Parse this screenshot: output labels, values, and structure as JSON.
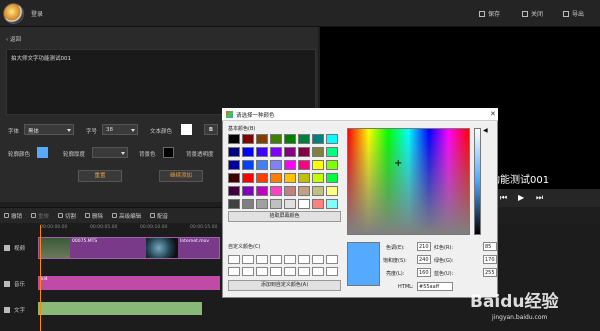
{
  "topbar": {
    "login_label": "登录",
    "buttons": [
      {
        "label": "保存",
        "icon": "save-icon"
      },
      {
        "label": "关闭",
        "icon": "close-icon"
      },
      {
        "label": "导出",
        "icon": "export-icon"
      }
    ]
  },
  "editor": {
    "back_label": "返回",
    "text_content": "拍大师文字功能测试001",
    "font_label": "字体",
    "font_value": "黑体",
    "size_label": "字号",
    "size_value": "38",
    "text_color_label": "文本颜色",
    "text_color": "#ffffff",
    "bold_label": "B",
    "outline_color_label": "轮廓颜色",
    "outline_color": "#55aaff",
    "outline_thickness_label": "轮廓厚度",
    "bg_color_label": "背景色",
    "bg_color": "#000000",
    "bg_opacity_label": "背景透明度",
    "reset_button": "重置",
    "continue_button": "继续添加"
  },
  "preview": {
    "overlay_text": "文字功能测试001"
  },
  "toolbar": {
    "items": [
      {
        "label": "撤销",
        "icon": "undo-icon",
        "disabled": false
      },
      {
        "label": "重做",
        "icon": "redo-icon",
        "disabled": true
      },
      {
        "label": "切割",
        "icon": "cut-icon",
        "disabled": false
      },
      {
        "label": "删除",
        "icon": "delete-icon",
        "disabled": false
      },
      {
        "label": "高级编辑",
        "icon": "advanced-edit-icon",
        "disabled": false
      },
      {
        "label": "配音",
        "icon": "microphone-icon",
        "disabled": false
      }
    ]
  },
  "timeline": {
    "ticks": [
      "00:00:00.00",
      "00:00:05.00",
      "00:00:10.00",
      "00:00:15.00"
    ],
    "tracks": [
      {
        "label": "视频",
        "icon": "video-icon"
      },
      {
        "label": "音乐",
        "icon": "music-icon"
      },
      {
        "label": "文字",
        "icon": "text-icon"
      }
    ],
    "video_clips": [
      "00075.MTS",
      "Internet.mov"
    ],
    "audio_clip": "kl4"
  },
  "color_dialog": {
    "title": "请选择一种颜色",
    "close_label": "✕",
    "basic_label": "基本颜色(B)",
    "basic_colors": [
      "#000000",
      "#800000",
      "#804000",
      "#408000",
      "#008000",
      "#008040",
      "#008080",
      "#00ffff",
      "#000080",
      "#0000ff",
      "#4000ff",
      "#8000ff",
      "#800080",
      "#800040",
      "#808040",
      "#00ff80",
      "#0000a0",
      "#0040ff",
      "#4080ff",
      "#8080ff",
      "#ff00ff",
      "#ff0080",
      "#ffff00",
      "#80ff00",
      "#400000",
      "#ff0000",
      "#ff4000",
      "#ff8000",
      "#ffc000",
      "#c0c000",
      "#c0ff00",
      "#00ff40",
      "#400040",
      "#8000c0",
      "#c000c0",
      "#ff40c0",
      "#c08080",
      "#c0a080",
      "#c0c080",
      "#ffff80",
      "#404040",
      "#808080",
      "#a0a0a0",
      "#c0c0c0",
      "#e0e0e0",
      "#ffffff",
      "#ff8080",
      "#80ffff"
    ],
    "pick_screen_button": "拾取屏幕颜色",
    "custom_label": "自定义颜色(C)",
    "add_custom_button": "添加到自定义颜色(A)",
    "hue_label": "色调(E):",
    "hue": "210",
    "sat_label": "饱和度(S):",
    "sat": "240",
    "lum_label": "亮度(L):",
    "lum": "160",
    "red_label": "红色(R):",
    "red": "85",
    "green_label": "绿色(G):",
    "green": "170",
    "blue_label": "蓝色(U):",
    "blue": "255",
    "html_label": "HTML:",
    "html": "#55aaff",
    "selected_color": "#55aaff"
  },
  "watermark": {
    "brand": "Baidu经验",
    "url": "jingyan.baidu.com"
  }
}
